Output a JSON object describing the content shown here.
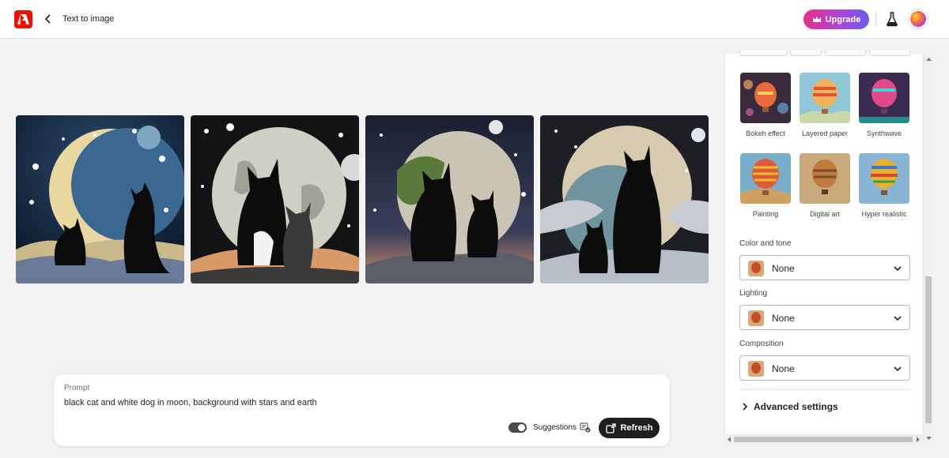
{
  "header": {
    "title": "Text to image",
    "upgrade_label": "Upgrade",
    "brand_color": "#eb1000"
  },
  "images": [
    {
      "name": "cat-and-kitten-crescent-moon"
    },
    {
      "name": "two-cats-full-moon"
    },
    {
      "name": "two-cats-earth-moon"
    },
    {
      "name": "cat-and-kitten-planet"
    }
  ],
  "prompt": {
    "label": "Prompt",
    "text": "black cat and white dog in moon, background with stars and earth",
    "suggestions_label": "Suggestions",
    "suggestions_enabled": true,
    "refresh_label": "Refresh"
  },
  "panel": {
    "effects": [
      {
        "label": "Bokeh effect",
        "icon": "balloon-bokeh"
      },
      {
        "label": "Layered paper",
        "icon": "balloon-paper"
      },
      {
        "label": "Synthwave",
        "icon": "balloon-synthwave"
      },
      {
        "label": "Painting",
        "icon": "balloon-painting"
      },
      {
        "label": "Digital art",
        "icon": "balloon-digital"
      },
      {
        "label": "Hyper realistic",
        "icon": "balloon-realistic"
      }
    ],
    "color_tone": {
      "label": "Color and tone",
      "value": "None"
    },
    "lighting": {
      "label": "Lighting",
      "value": "None"
    },
    "composition": {
      "label": "Composition",
      "value": "None"
    },
    "advanced_label": "Advanced settings"
  }
}
